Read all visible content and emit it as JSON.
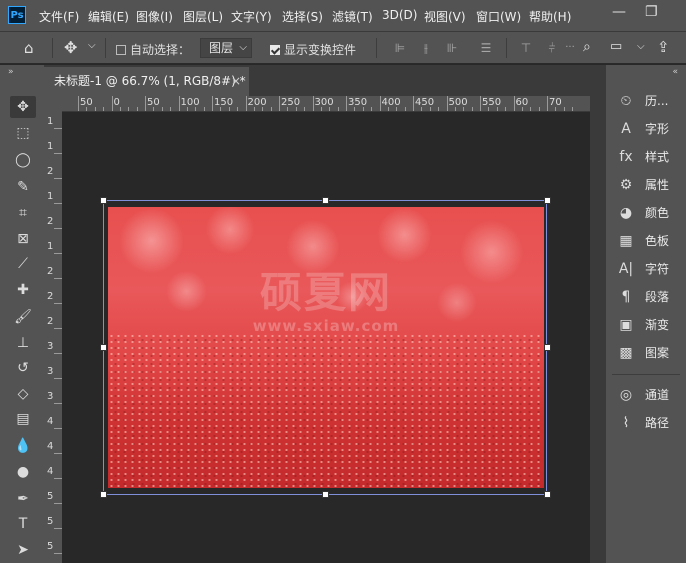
{
  "app": {
    "logo": "Ps"
  },
  "menu": [
    "文件(F)",
    "编辑(E)",
    "图像(I)",
    "图层(L)",
    "文字(Y)",
    "选择(S)",
    "滤镜(T)",
    "3D(D)",
    "视图(V)",
    "窗口(W)",
    "帮助(H)"
  ],
  "window_controls": [
    "minimize-icon",
    "restore-icon"
  ],
  "options_bar": {
    "auto_select_label": "自动选择：",
    "auto_select_checked": false,
    "layer_dropdown_value": "图层",
    "show_transform_label": "显示变换控件",
    "show_transform_checked": true
  },
  "document_tab": {
    "title": "未标题-1 @ 66.7% (1, RGB/8#) *",
    "close": "×"
  },
  "ruler_h_labels": [
    "50",
    "0",
    "50",
    "100",
    "150",
    "200",
    "250",
    "300",
    "350",
    "400",
    "450",
    "500",
    "550",
    "60",
    "70"
  ],
  "ruler_v_labels": [
    "1",
    "1",
    "2",
    "1",
    "2",
    "1",
    "2",
    "2",
    "2",
    "3",
    "3",
    "3",
    "4",
    "4",
    "4",
    "5",
    "5",
    "5"
  ],
  "canvas": {
    "watermark": "硕夏网",
    "watermark_url": "www.sxiaw.com"
  },
  "tools": [
    {
      "name": "move-tool",
      "icon": "move-icon",
      "glyph": "✥"
    },
    {
      "name": "marquee-tool",
      "icon": "rectangular-marquee-icon",
      "glyph": "⬚"
    },
    {
      "name": "lasso-tool",
      "icon": "lasso-icon",
      "glyph": "◯"
    },
    {
      "name": "quick-selection-tool",
      "icon": "quick-selection-icon",
      "glyph": "✎"
    },
    {
      "name": "crop-tool",
      "icon": "crop-icon",
      "glyph": "⌗"
    },
    {
      "name": "frame-tool",
      "icon": "frame-icon",
      "glyph": "⊠"
    },
    {
      "name": "eyedropper-tool",
      "icon": "eyedropper-icon",
      "glyph": "⟋"
    },
    {
      "name": "healing-brush-tool",
      "icon": "bandage-icon",
      "glyph": "✚"
    },
    {
      "name": "brush-tool",
      "icon": "brush-icon",
      "glyph": "🖌"
    },
    {
      "name": "clone-stamp-tool",
      "icon": "stamp-icon",
      "glyph": "⊥"
    },
    {
      "name": "history-brush-tool",
      "icon": "history-brush-icon",
      "glyph": "↺"
    },
    {
      "name": "eraser-tool",
      "icon": "eraser-icon",
      "glyph": "◇"
    },
    {
      "name": "gradient-tool",
      "icon": "gradient-icon",
      "glyph": "▤"
    },
    {
      "name": "blur-tool",
      "icon": "blur-icon",
      "glyph": "💧"
    },
    {
      "name": "dodge-tool",
      "icon": "dodge-icon",
      "glyph": "●"
    },
    {
      "name": "pen-tool",
      "icon": "pen-icon",
      "glyph": "✒"
    },
    {
      "name": "type-tool",
      "icon": "type-icon",
      "glyph": "T"
    },
    {
      "name": "path-selection-tool",
      "icon": "arrow-icon",
      "glyph": "➤"
    }
  ],
  "panels": [
    {
      "label": "历...",
      "icon": "history-icon",
      "glyph": "⏲"
    },
    {
      "label": "字形",
      "icon": "glyphs-icon",
      "glyph": "A"
    },
    {
      "label": "样式",
      "icon": "styles-icon",
      "glyph": "fx"
    },
    {
      "label": "属性",
      "icon": "properties-icon",
      "glyph": "⚙"
    },
    {
      "label": "颜色",
      "icon": "color-icon",
      "glyph": "◕"
    },
    {
      "label": "色板",
      "icon": "swatches-icon",
      "glyph": "▦"
    },
    {
      "label": "字符",
      "icon": "character-icon",
      "glyph": "A|"
    },
    {
      "label": "段落",
      "icon": "paragraph-icon",
      "glyph": "¶"
    },
    {
      "label": "渐变",
      "icon": "gradients-icon",
      "glyph": "▣"
    },
    {
      "label": "图案",
      "icon": "patterns-icon",
      "glyph": "▩"
    },
    {
      "label": "通道",
      "icon": "channels-icon",
      "glyph": "◎"
    },
    {
      "label": "路径",
      "icon": "paths-icon",
      "glyph": "⌇"
    }
  ]
}
